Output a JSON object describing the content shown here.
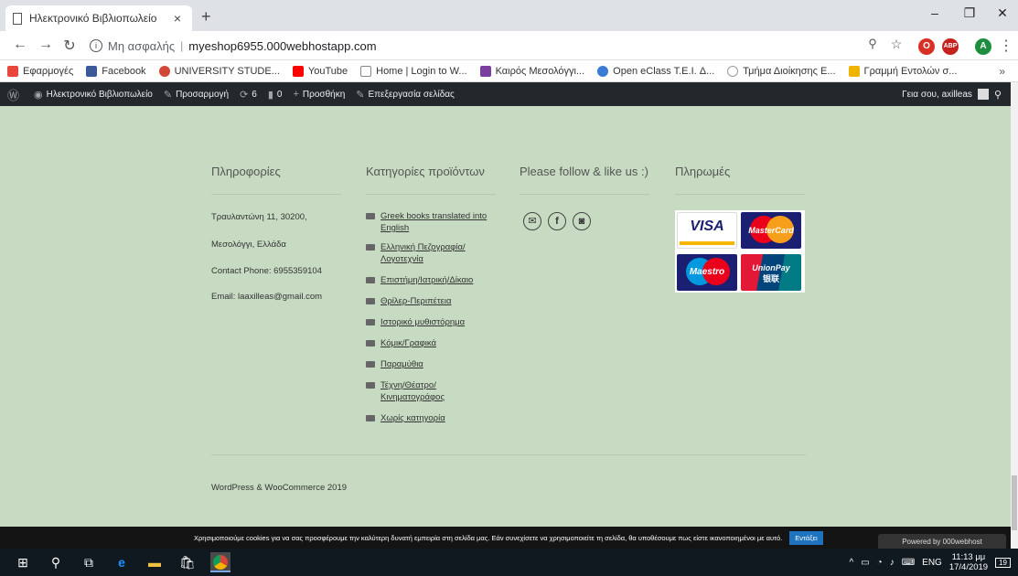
{
  "browser": {
    "tab_title": "Ηλεκτρονικό Βιβλιοπωλείο",
    "tab_close": "×",
    "new_tab": "+",
    "insecure_label": "Μη ασφαλής",
    "separator": "|",
    "url": "myeshop6955.000webhostapp.com"
  },
  "bookmarks": [
    {
      "label": "Εφαρμογές",
      "color": "#e8453c"
    },
    {
      "label": "Facebook",
      "color": "#3b5998"
    },
    {
      "label": "UNIVERSITY STUDE...",
      "color": "#d14836"
    },
    {
      "label": "YouTube",
      "color": "#ff0000"
    },
    {
      "label": "Home | Login to W...",
      "color": "#888888"
    },
    {
      "label": "Καιρός Μεσολόγγι...",
      "color": "#7b3fa0"
    },
    {
      "label": "Open eClass T.E.I. Δ...",
      "color": "#3a7bd5"
    },
    {
      "label": "Τμήμα Διοίκησης Ε...",
      "color": "#999999"
    },
    {
      "label": "Γραμμή Εντολών σ...",
      "color": "#f0b400"
    }
  ],
  "bookmarks_more": "»",
  "adminbar": {
    "site": "Ηλεκτρονικό Βιβλιοπωλείο",
    "customize": "Προσαρμογή",
    "updates": "6",
    "comments": "0",
    "new": "Προσθήκη",
    "edit": "Επεξεργασία σελίδας",
    "greeting": "Γεια σου, axilleas"
  },
  "footer": {
    "info_title": "Πληροφορίες",
    "address1": "Τραυλαντώνη 11, 30200,",
    "address2": "Μεσολόγγι, Ελλάδα",
    "phone": "Contact Phone: 6955359104",
    "email": "Email: laaxilleas@gmail.com",
    "categories_title": "Κατηγορίες προϊόντων",
    "categories": [
      "Greek books translated into English",
      "Ελληνική Πεζογραφία/ Λογοτεχνία",
      "Επιστήμη/Ιατρική/Δίκαιο",
      "Θρίλερ-Περιπέτεια",
      "Ιστορικό μυθιστόρημα",
      "Κόμικ/Γραφικά",
      "Παραμύθια",
      "Τέχνη/Θέατρο/ Κινηματογράφος",
      "Χωρίς κατηγορία"
    ],
    "follow_title": "Please follow & like us :)",
    "payments_title": "Πληρωμές",
    "credit": "WordPress & WooCommerce 2019"
  },
  "cards": {
    "visa": "VISA",
    "mastercard": "MasterCard",
    "maestro": "Maestro",
    "unionpay": "UnionPay",
    "unionpay_cn": "银联"
  },
  "cookie": {
    "text": "Χρησιμοποιούμε cookies για να σας προσφέρουμε την καλύτερη δυνατή εμπειρία στη σελίδα μας. Εάν συνεχίσετε να χρησιμοποιείτε τη σελίδα, θα υποθέσουμε πως είστε ικανοποιημένοι με αυτό.",
    "accept": "Εντάξει"
  },
  "powered": "Powered by 000webhost",
  "taskbar": {
    "lang": "ENG",
    "time": "11:13 μμ",
    "date": "17/4/2019",
    "notif": "19"
  }
}
